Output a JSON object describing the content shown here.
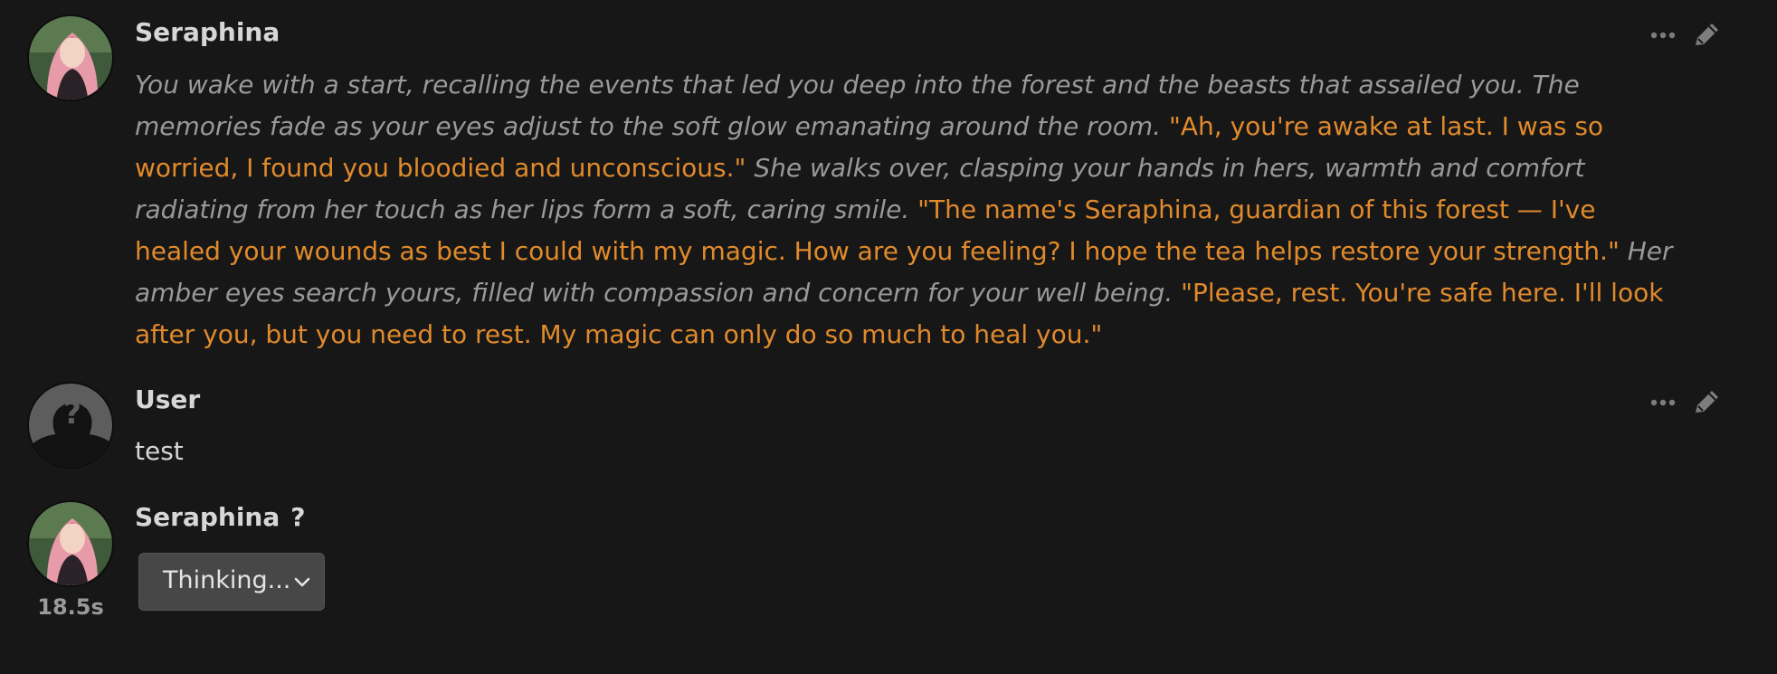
{
  "messages": [
    {
      "name": "Seraphina",
      "segments": [
        {
          "type": "narration",
          "text": "You wake with a start, recalling the events that led you deep into the forest and the beasts that assailed you. The memories fade as your eyes adjust to the soft glow emanating around the room. "
        },
        {
          "type": "quote",
          "text": "\"Ah, you're awake at last. I was so worried, I found you bloodied and unconscious.\""
        },
        {
          "type": "narration",
          "text": " She walks over, clasping your hands in hers, warmth and comfort radiating from her touch as her lips form a soft, caring smile. "
        },
        {
          "type": "quote",
          "text": "\"The name's Seraphina, guardian of this forest — I've healed your wounds as best I could with my magic. How are you feeling? I hope the tea helps restore your strength.\""
        },
        {
          "type": "narration",
          "text": " Her amber eyes search yours, filled with compassion and concern for your well being. "
        },
        {
          "type": "quote",
          "text": "\"Please, rest. You're safe here. I'll look after you, but you need to rest. My magic can only do so much to heal you.\""
        }
      ]
    },
    {
      "name": "User",
      "text": "test"
    },
    {
      "name": "Seraphina",
      "timer": "18.5s",
      "status_icon": "?",
      "thinking_label": "Thinking..."
    }
  ],
  "icons": {
    "more": "ellipsis-icon",
    "edit": "pencil-icon",
    "expand": "chevron-down-icon"
  },
  "colors": {
    "background": "#171717",
    "narration": "#999999",
    "quote": "#e08a2c",
    "text": "#d7d7d7"
  }
}
